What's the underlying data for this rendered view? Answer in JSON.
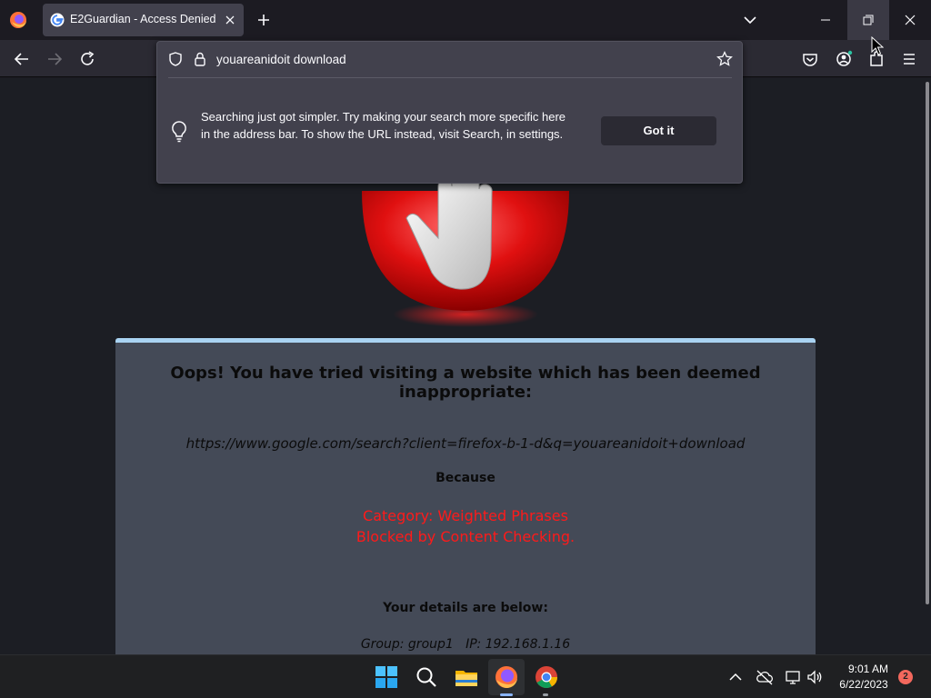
{
  "browser": {
    "tab": {
      "title": "E2Guardian - Access Denied"
    },
    "address_bar": {
      "value": "youareanidoit download"
    },
    "search_tip": {
      "message": "Searching just got simpler. Try making your search more specific here in the address bar. To show the URL instead, visit Search, in settings.",
      "button_label": "Got it"
    }
  },
  "page": {
    "heading": "Oops! You have tried visiting a website which has been deemed inappropriate:",
    "blocked_url": "https://www.google.com/search?client=firefox-b-1-d&q=youareanidoit+download",
    "because_label": "Because",
    "reason_lines": [
      "Category: Weighted Phrases",
      "Blocked by Content Checking."
    ],
    "details_heading": "Your details are below:",
    "details_line": "Group: group1   IP: 192.168.1.16"
  },
  "taskbar": {
    "time": "9:01 AM",
    "date": "6/22/2023",
    "notification_count": "2"
  },
  "colors": {
    "card_accent": "#a9d3f2",
    "reason_red": "#ff1a1a",
    "stop_sign_red": "#e01010"
  },
  "icons": [
    "firefox-icon",
    "google-favicon",
    "close-icon",
    "plus-icon",
    "chevron-down-icon",
    "minimize-icon",
    "restore-icon",
    "back-icon",
    "forward-icon",
    "reload-icon",
    "shield-icon",
    "lock-icon",
    "bookmark-star-icon",
    "pocket-icon",
    "account-icon",
    "extensions-icon",
    "menu-icon",
    "lightbulb-icon",
    "stop-hand-icon",
    "windows-start-icon",
    "search-icon",
    "file-explorer-icon",
    "chrome-icon",
    "chevron-up-icon",
    "cloud-off-icon",
    "network-icon",
    "volume-icon"
  ]
}
